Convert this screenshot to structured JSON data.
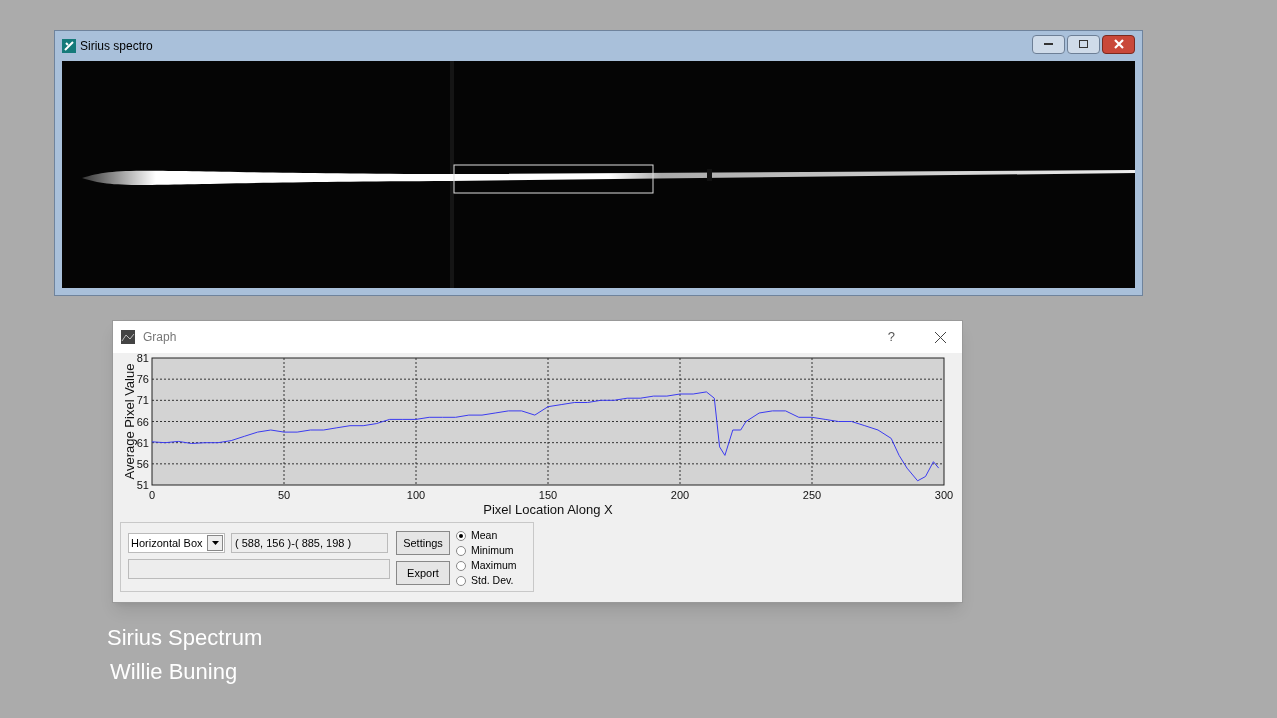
{
  "image_window": {
    "title": "Sirius spectro"
  },
  "graph_window": {
    "title": "Graph",
    "help": "?",
    "chart_data": {
      "type": "line",
      "grid": true,
      "xlabel": "Pixel Location Along X",
      "ylabel": "Average Pixel Value",
      "xlim": [
        0,
        300
      ],
      "ylim": [
        51,
        81
      ],
      "xticks": [
        0,
        50,
        100,
        150,
        200,
        250,
        300
      ],
      "yticks": [
        51,
        56,
        61,
        66,
        71,
        76,
        81
      ],
      "x": [
        0,
        5,
        10,
        15,
        20,
        25,
        30,
        35,
        40,
        45,
        50,
        55,
        60,
        65,
        70,
        75,
        80,
        85,
        90,
        95,
        100,
        105,
        110,
        115,
        120,
        125,
        130,
        135,
        140,
        145,
        150,
        155,
        160,
        165,
        170,
        175,
        180,
        185,
        190,
        195,
        200,
        205,
        210,
        213,
        215,
        217,
        220,
        223,
        225,
        230,
        235,
        240,
        245,
        250,
        255,
        260,
        265,
        270,
        275,
        280,
        283,
        286,
        290,
        293,
        296,
        298
      ],
      "series": [
        {
          "color": "#3b3bf0",
          "values": [
            61.2,
            61,
            61.3,
            60.8,
            61,
            61,
            61.5,
            62.5,
            63.5,
            64,
            63.5,
            63.5,
            64,
            64,
            64.5,
            65,
            65,
            65.5,
            66.5,
            66.5,
            66.5,
            67,
            67,
            67,
            67.5,
            67.5,
            68,
            68.5,
            68.5,
            67.5,
            69.5,
            70,
            70.5,
            70.5,
            71,
            71,
            71.5,
            71.5,
            72,
            72,
            72.5,
            72.5,
            73,
            71.5,
            60,
            58,
            64,
            64,
            66,
            68,
            68.5,
            68.5,
            67,
            67,
            66.5,
            66,
            66,
            65,
            64,
            62,
            58,
            55,
            52,
            53,
            56.5,
            55
          ]
        }
      ]
    },
    "controls": {
      "mode": "Horizontal Box",
      "region": "( 588, 156 )-( 885, 198 )",
      "buttons": [
        "Settings",
        "Export"
      ],
      "statistics": [
        {
          "label": "Mean",
          "selected": true
        },
        {
          "label": "Minimum",
          "selected": false
        },
        {
          "label": "Maximum",
          "selected": false
        },
        {
          "label": "Std. Dev.",
          "selected": false
        }
      ]
    }
  },
  "captions": [
    "Sirius Spectrum",
    "Willie Buning"
  ]
}
